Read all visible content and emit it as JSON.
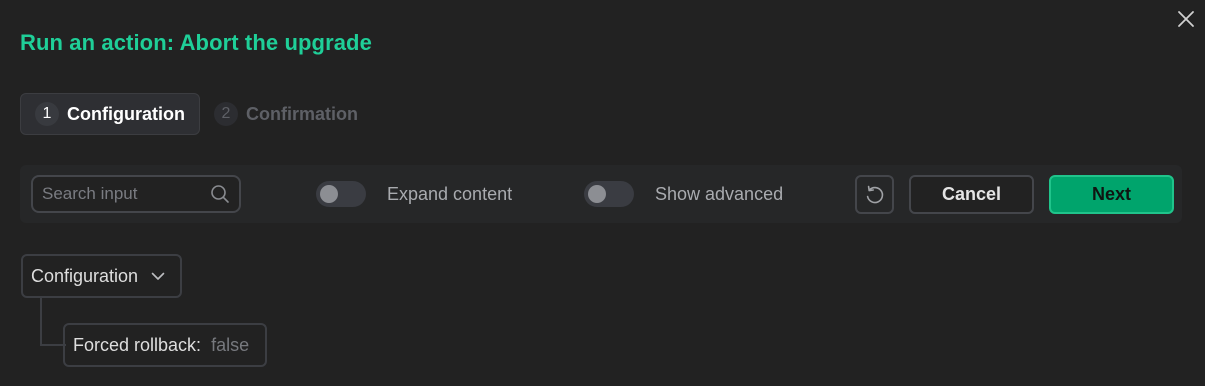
{
  "dialog": {
    "title": "Run an action: Abort the upgrade"
  },
  "steps": [
    {
      "number": "1",
      "label": "Configuration",
      "active": true
    },
    {
      "number": "2",
      "label": "Confirmation",
      "active": false
    }
  ],
  "toolbar": {
    "search_placeholder": "Search input",
    "search_value": "",
    "expand_content_label": "Expand content",
    "expand_content_on": false,
    "show_advanced_label": "Show advanced",
    "show_advanced_on": false,
    "cancel_label": "Cancel",
    "next_label": "Next"
  },
  "tree": {
    "root_label": "Configuration",
    "children": [
      {
        "key": "Forced rollback:",
        "value": "false"
      }
    ]
  },
  "icons": {
    "close": "close-icon",
    "search": "search-icon",
    "reset": "reset-icon",
    "chevron": "chevron-down-icon"
  },
  "colors": {
    "accent": "#1fcf98",
    "primary_button": "#00a46c",
    "background": "#222222"
  }
}
